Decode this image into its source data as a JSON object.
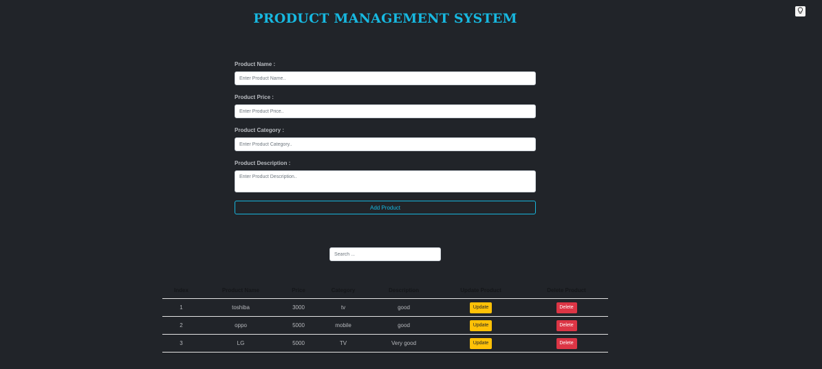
{
  "header": {
    "title": "PRODUCT MANAGEMENT SYSTEM"
  },
  "theme_toggle": {
    "icon": "lightbulb-icon"
  },
  "form": {
    "name": {
      "label": "Product Name :",
      "placeholder": "Enter Product Name..",
      "value": ""
    },
    "price": {
      "label": "Product Price :",
      "placeholder": "Enter Product Price..",
      "value": ""
    },
    "category": {
      "label": "Product Category :",
      "placeholder": "Enter Product Category..",
      "value": ""
    },
    "description": {
      "label": "Product Description :",
      "placeholder": "Enter Product Description..",
      "value": ""
    },
    "submit_label": "Add Product"
  },
  "search": {
    "placeholder": "Search ...",
    "value": ""
  },
  "table": {
    "columns": [
      "Index",
      "Product Name",
      "Price",
      "Category",
      "Description",
      "Update Product",
      "Delete Product"
    ],
    "rows": [
      {
        "index": "1",
        "name": "toshiba",
        "price": "3000",
        "category": "tv",
        "description": "good",
        "update_label": "Update",
        "delete_label": "Delete"
      },
      {
        "index": "2",
        "name": "oppo",
        "price": "5000",
        "category": "mobile",
        "description": "good",
        "update_label": "Update",
        "delete_label": "Delete"
      },
      {
        "index": "3",
        "name": "LG",
        "price": "5000",
        "category": "TV",
        "description": "Very good",
        "update_label": "Update",
        "delete_label": "Delete"
      }
    ]
  },
  "colors": {
    "background": "#212429",
    "accent": "#17b8e0",
    "update_button": "#ffc107",
    "delete_button": "#dc3545"
  }
}
